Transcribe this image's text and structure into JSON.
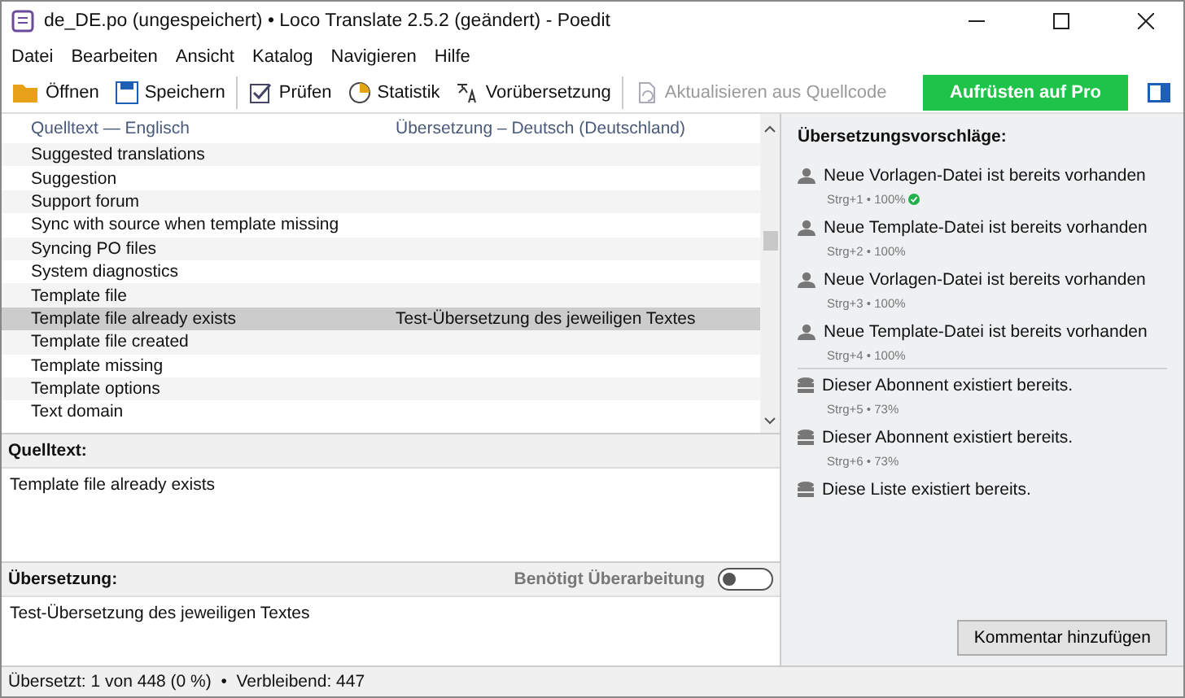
{
  "window": {
    "title": "de_DE.po (ungespeichert) • Loco Translate 2.5.2 (geändert) - Poedit"
  },
  "menu": [
    "Datei",
    "Bearbeiten",
    "Ansicht",
    "Katalog",
    "Navigieren",
    "Hilfe"
  ],
  "toolbar": [
    {
      "kind": "open",
      "label": "Öffnen",
      "disabled": false
    },
    {
      "kind": "save",
      "label": "Speichern",
      "disabled": false
    },
    {
      "kind": "separator"
    },
    {
      "kind": "check",
      "label": "Prüfen",
      "disabled": false
    },
    {
      "kind": "stats",
      "label": "Statistik",
      "disabled": false
    },
    {
      "kind": "translate",
      "label": "Vorübersetzung",
      "disabled": false
    },
    {
      "kind": "separator"
    },
    {
      "kind": "refresh",
      "label": "Aktualisieren aus Quellcode",
      "disabled": true
    }
  ],
  "upgrade_button": "Aufrüsten auf Pro",
  "table": {
    "columns": [
      "Quelltext — Englisch",
      "Übersetzung – Deutsch (Deutschland)"
    ],
    "rows": [
      {
        "source": "Suggested translations",
        "translation": "",
        "selected": false
      },
      {
        "source": "Suggestion",
        "translation": "",
        "selected": false
      },
      {
        "source": "Support forum",
        "translation": "",
        "selected": false
      },
      {
        "source": "Sync with source when template missing",
        "translation": "",
        "selected": false
      },
      {
        "source": "Syncing PO files",
        "translation": "",
        "selected": false
      },
      {
        "source": "System diagnostics",
        "translation": "",
        "selected": false
      },
      {
        "source": "Template file",
        "translation": "",
        "selected": false
      },
      {
        "source": "Template file already exists",
        "translation": "Test-Übersetzung des jeweiligen Textes",
        "selected": true
      },
      {
        "source": "Template file created",
        "translation": "",
        "selected": false
      },
      {
        "source": "Template missing",
        "translation": "",
        "selected": false
      },
      {
        "source": "Template options",
        "translation": "",
        "selected": false
      },
      {
        "source": "Text domain",
        "translation": "",
        "selected": false
      }
    ]
  },
  "source_panel": {
    "label": "Quelltext:",
    "text": "Template file already exists"
  },
  "translation_panel": {
    "label": "Übersetzung:",
    "needs_review_label": "Benötigt Überarbeitung",
    "needs_review": false,
    "text": "Test-Übersetzung des jeweiligen Textes"
  },
  "suggestions": {
    "title": "Übersetzungsvorschläge:",
    "items": [
      {
        "kind": "person",
        "text": "Neue Vorlagen-Datei ist bereits vorhanden",
        "meta": "Strg+1 • 100%",
        "verified": true
      },
      {
        "kind": "person",
        "text": "Neue Template-Datei ist bereits vorhanden",
        "meta": "Strg+2 • 100%",
        "verified": false
      },
      {
        "kind": "person",
        "text": "Neue Vorlagen-Datei ist bereits vorhanden",
        "meta": "Strg+3 • 100%",
        "verified": false
      },
      {
        "kind": "person",
        "text": "Neue Template-Datei ist bereits vorhanden",
        "meta": "Strg+4 • 100%",
        "verified": false
      },
      {
        "kind": "memory",
        "text": "Dieser Abonnent existiert bereits.",
        "meta": "Strg+5 • 73%",
        "verified": false
      },
      {
        "kind": "memory",
        "text": "Dieser Abonnent existiert bereits.",
        "meta": "Strg+6 • 73%",
        "verified": false
      },
      {
        "kind": "memory",
        "text": "Diese Liste existiert bereits.",
        "verified": false
      }
    ],
    "comment_button": "Kommentar hinzufügen"
  },
  "status_bar": "Übersetzt: 1 von 448 (0 %)  •  Verbleibend: 447"
}
